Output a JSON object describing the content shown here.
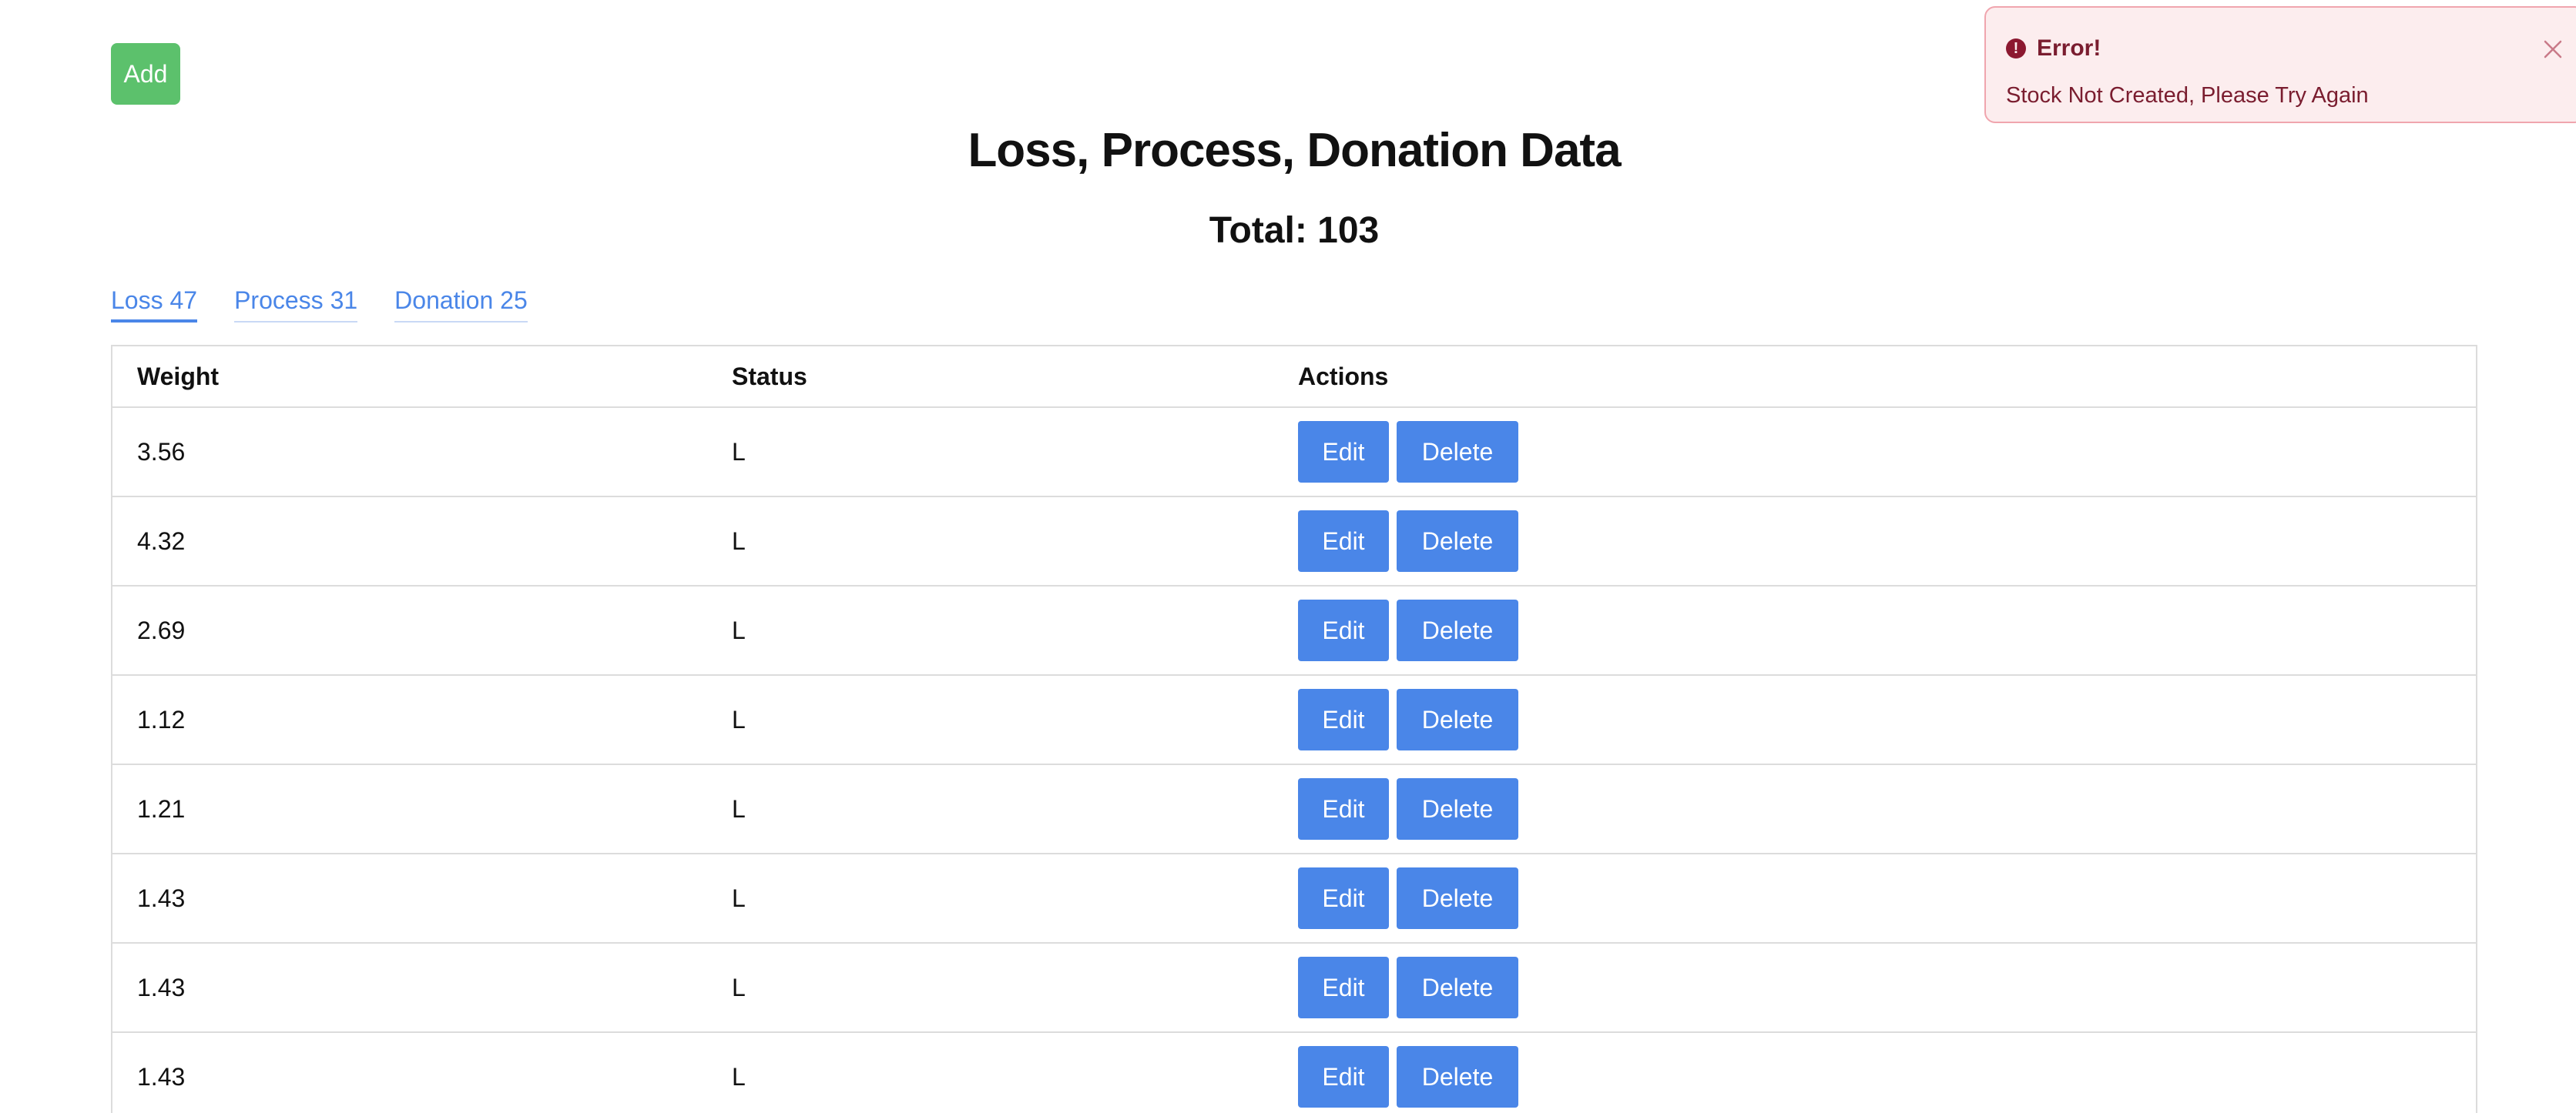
{
  "toolbar": {
    "add_label": "Add"
  },
  "header": {
    "title": "Loss, Process, Donation Data",
    "total": "Total: 103"
  },
  "tabs": [
    {
      "label": "Loss 47",
      "active": true
    },
    {
      "label": "Process 31",
      "active": false
    },
    {
      "label": "Donation 25",
      "active": false
    }
  ],
  "table": {
    "columns": [
      "Weight",
      "Status",
      "Actions"
    ],
    "edit_label": "Edit",
    "delete_label": "Delete",
    "rows": [
      {
        "weight": "3.56",
        "status": "L"
      },
      {
        "weight": "4.32",
        "status": "L"
      },
      {
        "weight": "2.69",
        "status": "L"
      },
      {
        "weight": "1.12",
        "status": "L"
      },
      {
        "weight": "1.21",
        "status": "L"
      },
      {
        "weight": "1.43",
        "status": "L"
      },
      {
        "weight": "1.43",
        "status": "L"
      },
      {
        "weight": "1.43",
        "status": "L"
      }
    ]
  },
  "toast": {
    "icon": "exclamation-circle-icon",
    "title": "Error!",
    "message": "Stock Not Created, Please Try Again",
    "close_icon": "close-icon"
  },
  "colors": {
    "add_button": "#5cc16c",
    "action_button": "#4a86e8",
    "tab_link": "#4a86e8",
    "toast_bg": "#fcedee",
    "toast_border": "#f0a5ae",
    "toast_text": "#7a1d2f"
  }
}
